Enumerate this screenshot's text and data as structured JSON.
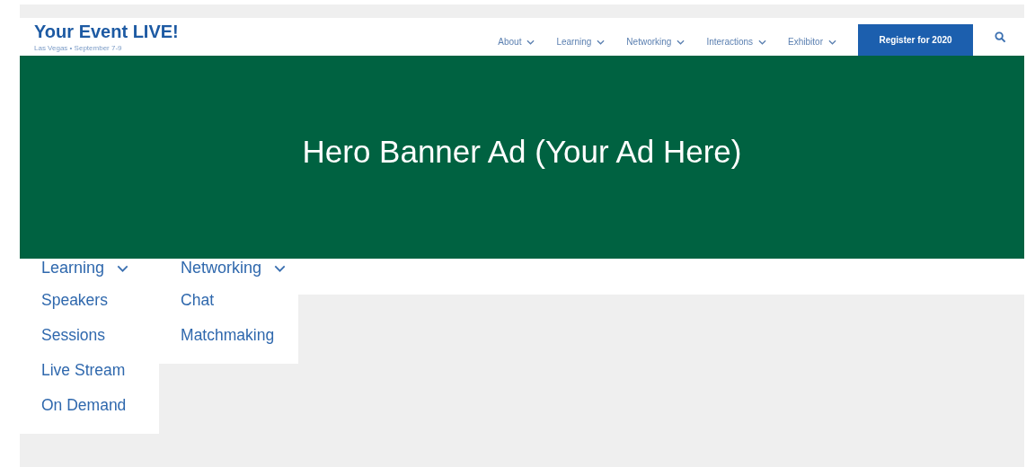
{
  "header": {
    "title": "Your Event LIVE!",
    "subtitle": "Las Vegas • September 7-9",
    "nav": [
      {
        "label": "About"
      },
      {
        "label": "Learning"
      },
      {
        "label": "Networking"
      },
      {
        "label": "Interactions"
      },
      {
        "label": "Exhibitor"
      }
    ],
    "register_button": "Register for 2020"
  },
  "banner": {
    "text": "Hero Banner Ad (Your Ad Here)"
  },
  "menus": [
    {
      "label": "Learning",
      "items": [
        "Speakers",
        "Sessions",
        "Live Stream",
        "On Demand"
      ]
    },
    {
      "label": "Networking",
      "items": [
        "Chat",
        "Matchmaking"
      ]
    }
  ]
}
